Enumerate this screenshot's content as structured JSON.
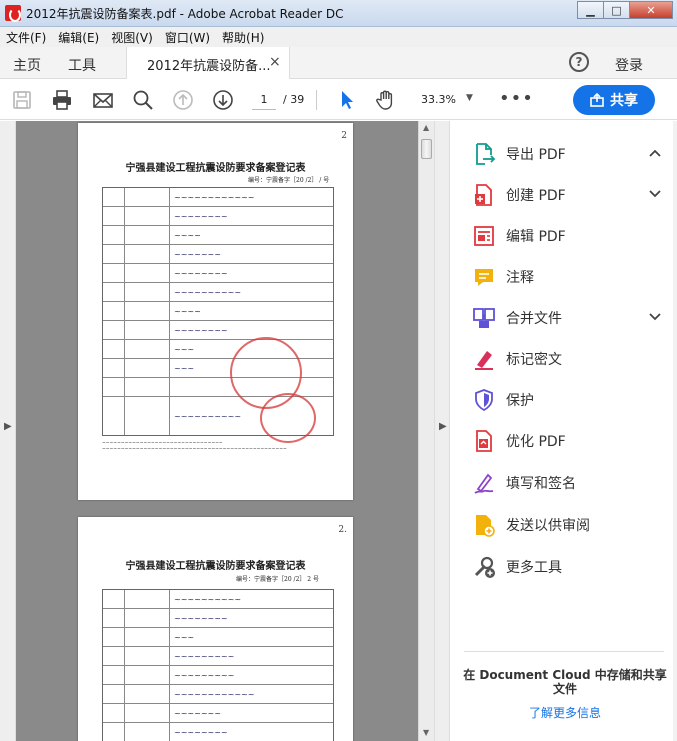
{
  "window": {
    "title": "2012年抗震设防备案表.pdf - Adobe Acrobat Reader DC",
    "minimize": "▁",
    "maximize": "□",
    "close": "✕"
  },
  "menu": [
    "文件(F)",
    "编辑(E)",
    "视图(V)",
    "窗口(W)",
    "帮助(H)"
  ],
  "tabs": {
    "home": "主页",
    "tools": "工具",
    "document": "2012年抗震设防备...",
    "close": "×",
    "help": "?",
    "login": "登录"
  },
  "toolbar": {
    "page_current": "1",
    "page_total": "/ 39",
    "zoom": "33.3%",
    "zoom_arrow": "▼",
    "more": "•••",
    "share": "共享"
  },
  "document": {
    "page1": {
      "page_number": "2",
      "title": "宁强县建设工程抗震设防要求备案登记表",
      "code": "编号：宁震备字［20 /2］ / 号"
    },
    "page2": {
      "page_number": "2.",
      "title": "宁强县建设工程抗震设防要求备案登记表",
      "code": "编号：宁震备字［20 /2］ 2 号"
    }
  },
  "tools": [
    {
      "label": "导出 PDF",
      "icon": "export-pdf-icon",
      "color": "#0f9d8f",
      "chevron": "up"
    },
    {
      "label": "创建 PDF",
      "icon": "create-pdf-icon",
      "color": "#e0393e",
      "chevron": "down"
    },
    {
      "label": "编辑 PDF",
      "icon": "edit-pdf-icon",
      "color": "#e0393e",
      "chevron": ""
    },
    {
      "label": "注释",
      "icon": "comment-icon",
      "color": "#f2b10b",
      "chevron": ""
    },
    {
      "label": "合并文件",
      "icon": "combine-files-icon",
      "color": "#5e52d6",
      "chevron": "down"
    },
    {
      "label": "标记密文",
      "icon": "redact-icon",
      "color": "#d9325a",
      "chevron": ""
    },
    {
      "label": "保护",
      "icon": "protect-icon",
      "color": "#5e52d6",
      "chevron": ""
    },
    {
      "label": "优化 PDF",
      "icon": "optimize-pdf-icon",
      "color": "#e0393e",
      "chevron": ""
    },
    {
      "label": "填写和签名",
      "icon": "fill-sign-icon",
      "color": "#8e44c7",
      "chevron": ""
    },
    {
      "label": "发送以供审阅",
      "icon": "send-review-icon",
      "color": "#f2b10b",
      "chevron": ""
    },
    {
      "label": "更多工具",
      "icon": "more-tools-icon",
      "color": "#555555",
      "chevron": ""
    }
  ],
  "cloud": {
    "text": "在 Document Cloud 中存储和共享文件",
    "link": "了解更多信息"
  },
  "colors": {
    "accent": "#1473e6"
  }
}
